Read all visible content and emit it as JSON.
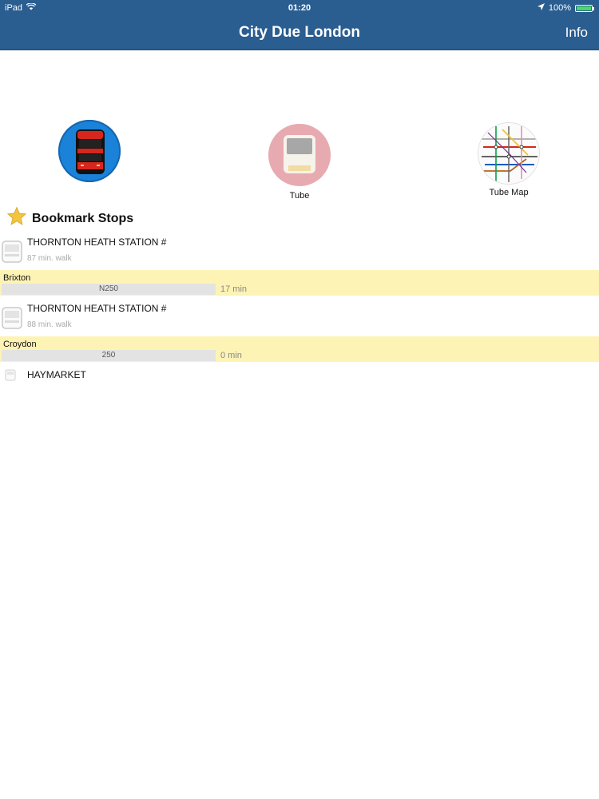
{
  "status": {
    "device": "iPad",
    "time": "01:20",
    "battery": "100%",
    "battery_level": 1.0
  },
  "navbar": {
    "title": "City Due London",
    "info_label": "Info"
  },
  "launchers": {
    "bus_label": "",
    "tube_label": "Tube",
    "map_label": "Tube Map"
  },
  "bookmarks": {
    "title": "Bookmark Stops",
    "stops": [
      {
        "name": "THORNTON HEATH STATION #",
        "walk": "87 min. walk",
        "destination": "Brixton",
        "route": "N250",
        "eta": "17 min"
      },
      {
        "name": "THORNTON HEATH STATION #",
        "walk": "88 min. walk",
        "destination": "Croydon",
        "route": "250",
        "eta": "0 min"
      },
      {
        "name": "HAYMARKET"
      }
    ]
  },
  "colors": {
    "nav_bg": "#2a5d90",
    "route_band": "#fdf3b5",
    "bus_icon_bg": "#1a82d8",
    "tube_icon_bg": "#e7aab0",
    "battery_fill": "#4cd964"
  }
}
